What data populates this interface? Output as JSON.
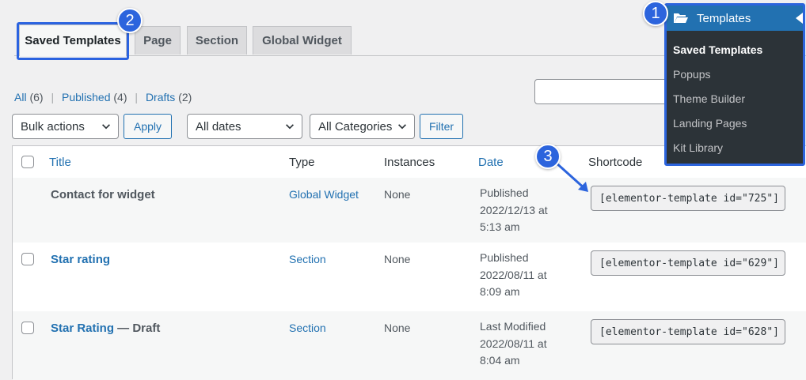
{
  "tabs": [
    {
      "label": "Saved Templates"
    },
    {
      "label": "Page"
    },
    {
      "label": "Section"
    },
    {
      "label": "Global Widget"
    }
  ],
  "filters_links": {
    "all_label": "All",
    "all_count": "(6)",
    "published_label": "Published",
    "published_count": "(4)",
    "drafts_label": "Drafts",
    "drafts_count": "(2)",
    "separator": "|"
  },
  "controls": {
    "bulk_actions": "Bulk actions",
    "apply": "Apply",
    "dates": "All dates",
    "categories": "All Categories",
    "filter": "Filter"
  },
  "table": {
    "headers": {
      "title": "Title",
      "type": "Type",
      "instances": "Instances",
      "date": "Date",
      "shortcode": "Shortcode"
    },
    "rows": [
      {
        "title": "Contact for widget",
        "title_suffix": "",
        "type": "Global Widget",
        "instances": "None",
        "date_status": "Published",
        "date_day": "2022/12/13 at",
        "date_time": "5:13 am",
        "shortcode": "[elementor-template id=\"725\"]"
      },
      {
        "title": "Star rating",
        "title_suffix": "",
        "type": "Section",
        "instances": "None",
        "date_status": "Published",
        "date_day": "2022/08/11 at",
        "date_time": "8:09 am",
        "shortcode": "[elementor-template id=\"629\"]"
      },
      {
        "title": "Star Rating",
        "title_suffix": " — Draft",
        "type": "Section",
        "instances": "None",
        "date_status": "Last Modified",
        "date_day": "2022/08/11 at",
        "date_time": "8:04 am",
        "shortcode": "[elementor-template id=\"628\"]"
      }
    ]
  },
  "admin_menu": {
    "header": "Templates",
    "items": [
      {
        "label": "Saved Templates",
        "current": true
      },
      {
        "label": "Popups"
      },
      {
        "label": "Theme Builder"
      },
      {
        "label": "Landing Pages"
      },
      {
        "label": "Kit Library"
      }
    ]
  },
  "callouts": {
    "one": "1",
    "two": "2",
    "three": "3"
  },
  "colors": {
    "accent": "#2271b1",
    "highlight": "#2c64dd",
    "menu_bg": "#2c3338"
  },
  "icons": {
    "menu": "folder-open-icon",
    "dropdown": "chevron-down-icon"
  }
}
